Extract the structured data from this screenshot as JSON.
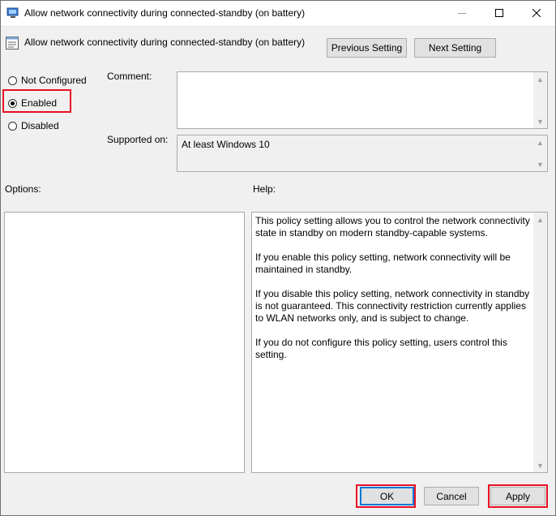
{
  "window": {
    "title": "Allow network connectivity during connected-standby (on battery)",
    "icons": {
      "app": "policy-app-icon",
      "minimize": "minimize-icon",
      "maximize": "maximize-icon",
      "close": "close-icon"
    }
  },
  "header": {
    "setting_title": "Allow network connectivity during connected-standby (on battery)",
    "setting_icon": "policy-setting-icon",
    "previous_label": "Previous Setting",
    "next_label": "Next Setting"
  },
  "state": {
    "options": [
      {
        "label": "Not Configured",
        "checked": false
      },
      {
        "label": "Enabled",
        "checked": true
      },
      {
        "label": "Disabled",
        "checked": false
      }
    ]
  },
  "comment": {
    "label": "Comment:",
    "value": ""
  },
  "supported": {
    "label": "Supported on:",
    "value": "At least Windows 10"
  },
  "options_panel": {
    "label": "Options:"
  },
  "help": {
    "label": "Help:",
    "paragraphs": [
      "This policy setting allows you to control the network connectivity state in standby on modern standby-capable systems.",
      "If you enable this policy setting, network connectivity will be maintained in standby.",
      "If you disable this policy setting, network connectivity in standby is not guaranteed. This connectivity restriction currently applies to WLAN networks only, and is subject to change.",
      "If you do not configure this policy setting, users control this setting."
    ]
  },
  "footer": {
    "ok_label": "OK",
    "cancel_label": "Cancel",
    "apply_label": "Apply"
  },
  "colors": {
    "highlight": "#e81123",
    "accent": "#0078d7"
  }
}
